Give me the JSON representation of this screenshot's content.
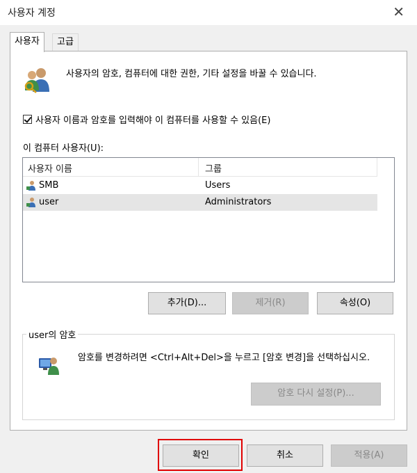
{
  "window": {
    "title": "사용자 계정",
    "close_glyph": "✕"
  },
  "tabs": [
    {
      "label": "사용자",
      "active": true
    },
    {
      "label": "고급",
      "active": false
    }
  ],
  "description": "사용자의 암호, 컴퓨터에 대한 권한, 기타 설정을 바꿀 수 있습니다.",
  "require_login": {
    "label": "사용자 이름과 암호를 입력해야 이 컴퓨터를 사용할 수 있음(E)",
    "checked": true
  },
  "users_list": {
    "label": "이 컴퓨터 사용자(U):",
    "columns": [
      "사용자 이름",
      "그룹"
    ],
    "rows": [
      {
        "name": "SMB",
        "group": "Users",
        "selected": false
      },
      {
        "name": "user",
        "group": "Administrators",
        "selected": true
      }
    ]
  },
  "list_buttons": {
    "add": "추가(D)...",
    "remove": "제거(R)",
    "properties": "속성(O)"
  },
  "password_group": {
    "label": "user의 암호",
    "text": "암호를 변경하려면 <Ctrl+Alt+Del>을 누르고 [암호 변경]을 선택하십시오.",
    "reset_button": "암호 다시 설정(P)..."
  },
  "dialog_buttons": {
    "ok": "확인",
    "cancel": "취소",
    "apply": "적용(A)"
  },
  "colors": {
    "highlight": "#e00000",
    "selected_row": "#e5e5e5"
  }
}
